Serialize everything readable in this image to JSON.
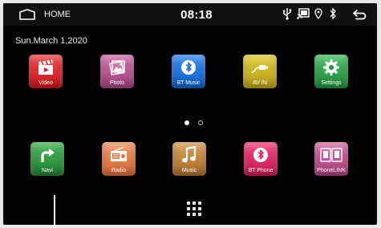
{
  "statusbar": {
    "home_label": "HOME",
    "time": "08:18",
    "icons": [
      "usb-icon",
      "cast-icon",
      "location-icon",
      "bluetooth-icon"
    ]
  },
  "date": "Sun.March 1,2020",
  "row1": [
    {
      "label": "Video",
      "icon": "film-clapper-icon",
      "color": "#e2252b"
    },
    {
      "label": "Photo",
      "icon": "photo-icon",
      "color": "#b4508f"
    },
    {
      "label": "BT Music",
      "icon": "bluetooth-music-icon",
      "color": "#1770d8"
    },
    {
      "label": "AV IN",
      "icon": "av-in-icon",
      "color": "#c9b322"
    },
    {
      "label": "Settings",
      "icon": "gear-icon",
      "color": "#2da04a"
    }
  ],
  "row2": [
    {
      "label": "Navi",
      "icon": "turn-arrow-icon",
      "color": "#2e9b3e"
    },
    {
      "label": "Radio",
      "icon": "radio-icon",
      "color": "#ec7d49"
    },
    {
      "label": "Music",
      "icon": "music-note-icon",
      "color": "#c88a3f"
    },
    {
      "label": "BT Phone",
      "icon": "bluetooth-phone-icon",
      "color": "#e82a6c"
    },
    {
      "label": "PhoneLINK",
      "icon": "phonelink-icon",
      "color": "#c25593"
    }
  ],
  "pager": {
    "pages": 2,
    "current": 1
  },
  "colors": {
    "background": "#020202",
    "statusbar": "#111111",
    "text": "#ffffff"
  }
}
